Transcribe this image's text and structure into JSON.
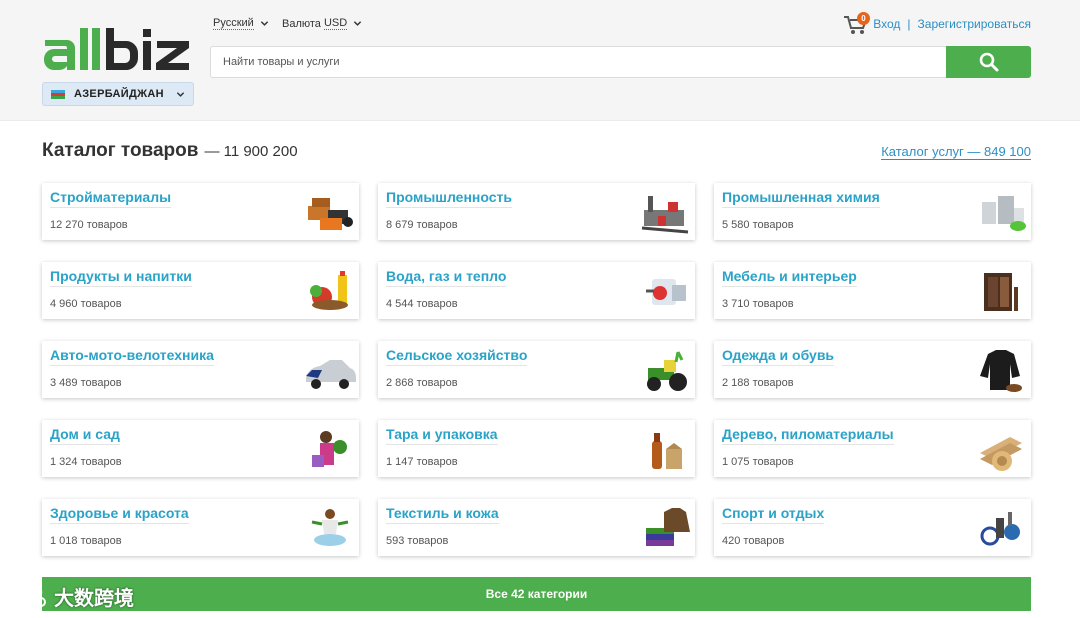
{
  "header": {
    "logo_text": "allbiz",
    "country": "АЗЕРБАЙДЖАН",
    "language": "Русский",
    "currency_label": "Валюта",
    "currency_value": "USD",
    "cart_count": "0",
    "login": "Вход",
    "separator": "|",
    "register": "Зарегистрироваться",
    "search_placeholder": "Найти товары и услуги"
  },
  "catalog": {
    "title": "Каталог товаров",
    "count": "— 11 900 200",
    "services_link": "Каталог услуг — 849 100",
    "categories": [
      {
        "name": "Стройматериалы",
        "count": "12 270 товаров",
        "icon": "building-materials-icon"
      },
      {
        "name": "Промышленность",
        "count": "8 679 товаров",
        "icon": "industry-icon"
      },
      {
        "name": "Промышленная химия",
        "count": "5 580 товаров",
        "icon": "chemistry-icon"
      },
      {
        "name": "Продукты и напитки",
        "count": "4 960 товаров",
        "icon": "food-drinks-icon"
      },
      {
        "name": "Вода, газ и тепло",
        "count": "4 544 товаров",
        "icon": "water-gas-heat-icon"
      },
      {
        "name": "Мебель и интерьер",
        "count": "3 710 товаров",
        "icon": "furniture-icon"
      },
      {
        "name": "Авто-мото-велотехника",
        "count": "3 489 товаров",
        "icon": "car-icon"
      },
      {
        "name": "Сельское хозяйство",
        "count": "2 868 товаров",
        "icon": "tractor-icon"
      },
      {
        "name": "Одежда и обувь",
        "count": "2 188 товаров",
        "icon": "clothing-icon"
      },
      {
        "name": "Дом и сад",
        "count": "1 324 товаров",
        "icon": "home-garden-icon"
      },
      {
        "name": "Тара и упаковка",
        "count": "1 147 товаров",
        "icon": "packaging-icon"
      },
      {
        "name": "Дерево, пиломатериалы",
        "count": "1 075 товаров",
        "icon": "wood-icon"
      },
      {
        "name": "Здоровье и красота",
        "count": "1 018 товаров",
        "icon": "health-beauty-icon"
      },
      {
        "name": "Текстиль и кожа",
        "count": "593 товаров",
        "icon": "textile-icon"
      },
      {
        "name": "Спорт и отдых",
        "count": "420 товаров",
        "icon": "sport-icon"
      }
    ],
    "all_categories": "Все 42 категории"
  },
  "watermark": "大数跨境",
  "colors": {
    "brand_green": "#4cae4c",
    "link_blue": "#2aa3c8",
    "badge_orange": "#e8641b"
  }
}
